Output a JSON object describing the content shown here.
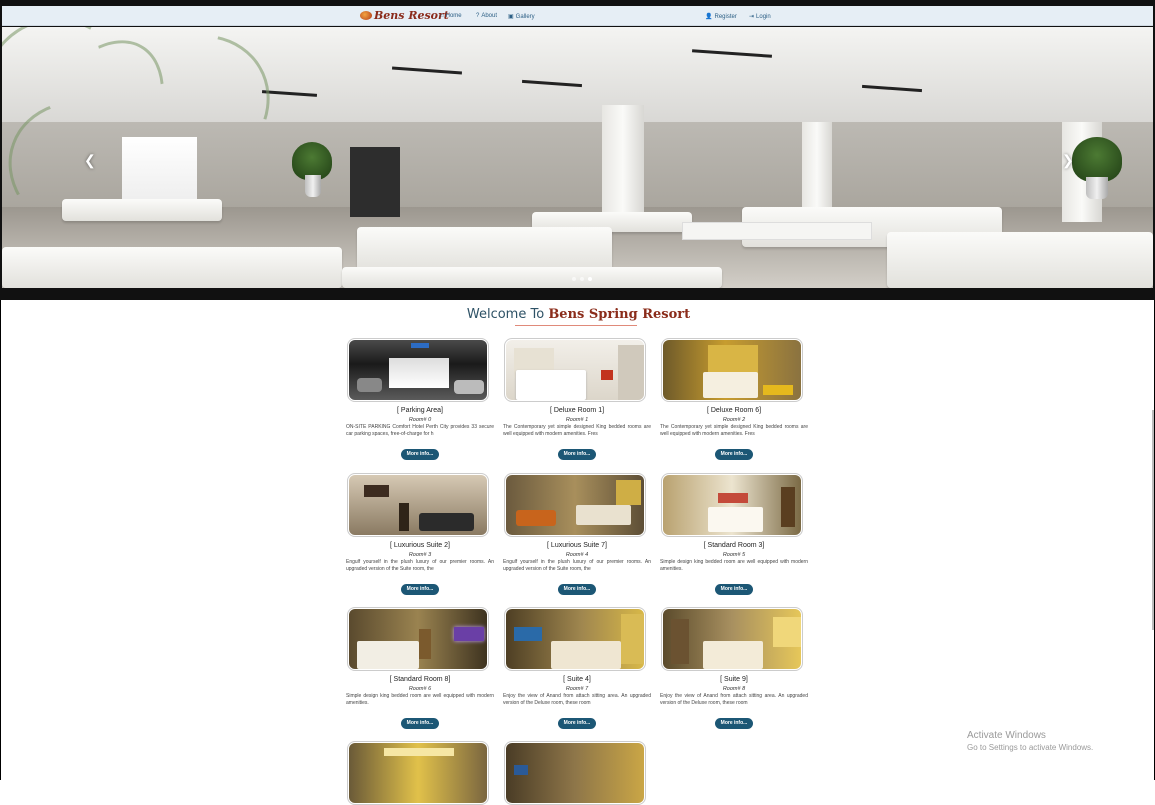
{
  "nav": {
    "brand": "Bens Resort",
    "home": "Home",
    "about": "About",
    "gallery": "Gallery",
    "register": "Register",
    "login": "Login"
  },
  "hero": {
    "prev_icon": "chevron-left-icon",
    "next_icon": "chevron-right-icon",
    "slides": 3,
    "active_slide": 2
  },
  "welcome": {
    "prefix": "Welcome To",
    "name": "Bens Spring Resort"
  },
  "rooms": [
    {
      "title": "[ Parking Area]",
      "num": "Room# 0",
      "desc": "ON-SITE PARKING Comfort Hotel Perth City provides 33 secure car parking spaces, free-of-charge for h",
      "button": "More info..."
    },
    {
      "title": "[ Deluxe Room 1]",
      "num": "Room# 1",
      "desc": "The Contemporary yet simple designed King bedded rooms are well equipped with modern amenities. Fres",
      "button": "More info..."
    },
    {
      "title": "[ Deluxe Room 6]",
      "num": "Room# 2",
      "desc": "The Contemporary yet simple designed King bedded rooms are well equipped with modern amenities. Fres",
      "button": "More info..."
    },
    {
      "title": "[ Luxurious Suite 2]",
      "num": "Room# 3",
      "desc": "Engulf yourself in the plush luxury of our premier rooms. An upgraded version of the Suite room, the",
      "button": "More info..."
    },
    {
      "title": "[ Luxurious Suite 7]",
      "num": "Room# 4",
      "desc": "Engulf yourself in the plush luxury of our premier rooms. An upgraded version of the Suite room, the",
      "button": "More info..."
    },
    {
      "title": "[ Standard Room 3]",
      "num": "Room# 5",
      "desc": "Simple design king bedded room are well equipped with modern amenities.",
      "button": "More info..."
    },
    {
      "title": "[ Standard Room 8]",
      "num": "Room# 6",
      "desc": "Simple design king bedded room are well equipped with modern amenities.",
      "button": "More info..."
    },
    {
      "title": "[ Suite 4]",
      "num": "Room# 7",
      "desc": "Enjoy the view of Anand from attach sitting area. An upgraded version of the Deluxe room, these room",
      "button": "More info..."
    },
    {
      "title": "[ Suite 9]",
      "num": "Room# 8",
      "desc": "Enjoy the view of Anand from attach sitting area. An upgraded version of the Deluxe room, these room",
      "button": "More info..."
    }
  ],
  "watermark": {
    "line1": "Activate Windows",
    "line2": "Go to Settings to activate Windows."
  }
}
